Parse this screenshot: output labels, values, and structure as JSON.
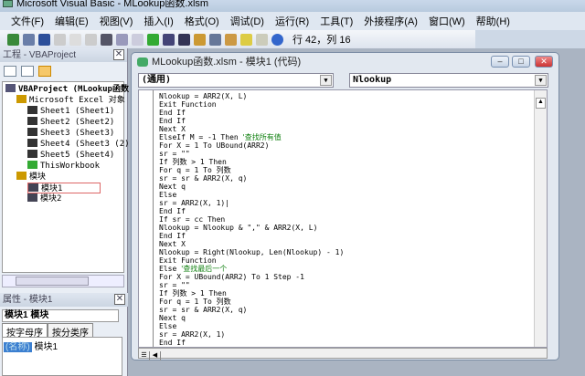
{
  "window": {
    "title": "Microsoft Visual Basic - MLookup函数.xlsm"
  },
  "menu": [
    "文件(F)",
    "编辑(E)",
    "视图(V)",
    "插入(I)",
    "格式(O)",
    "调试(D)",
    "运行(R)",
    "工具(T)",
    "外接程序(A)",
    "窗口(W)",
    "帮助(H)"
  ],
  "toolbar": {
    "position": "行 42，列 16"
  },
  "project": {
    "title": "工程 - VBAProject",
    "close": "✕",
    "nodes": [
      "VBAProject (MLookup函数",
      "Microsoft Excel 对象",
      "Sheet1 (Sheet1)",
      "Sheet2 (Sheet2)",
      "Sheet3 (Sheet3)",
      "Sheet4 (Sheet3 (2))",
      "Sheet5 (Sheet4)",
      "ThisWorkbook",
      "模块",
      "模块1",
      "模块2"
    ]
  },
  "properties": {
    "title": "属性 - 模块1",
    "close": "✕",
    "object": "模块1 模块",
    "tabs": [
      "按字母序",
      "按分类序"
    ],
    "prop_name": "(名称)",
    "prop_value": "模块1"
  },
  "code_window": {
    "title": "MLookup函数.xlsm - 模块1 (代码)",
    "object_combo": "(通用)",
    "proc_combo": "Nlookup",
    "lines": [
      {
        "t": "Nlookup = ARR2(X, L)"
      },
      {
        "t": "Exit Function"
      },
      {
        "t": "End If"
      },
      {
        "t": "End If"
      },
      {
        "t": "Next X"
      },
      {
        "t": "ElseIf M = -1 Then ",
        "c": "'查找所有值"
      },
      {
        "t": "For X = 1 To UBound(ARR2)"
      },
      {
        "t": "sr = \"\""
      },
      {
        "t": "If 列数 > 1 Then"
      },
      {
        "t": "For q = 1 To 列数"
      },
      {
        "t": "sr = sr & ARR2(X, q)"
      },
      {
        "t": "Next q"
      },
      {
        "t": "Else"
      },
      {
        "t": "sr = ARR2(X, 1)|"
      },
      {
        "t": "End If"
      },
      {
        "t": "If sr = cc Then"
      },
      {
        "t": "Nlookup = Nlookup & \",\" & ARR2(X, L)"
      },
      {
        "t": "End If"
      },
      {
        "t": "Next X"
      },
      {
        "t": "Nlookup = Right(Nlookup, Len(Nlookup) - 1)"
      },
      {
        "t": "Exit Function"
      },
      {
        "t": "Else ",
        "c": "'查找最后一个"
      },
      {
        "t": "For X = UBound(ARR2) To 1 Step -1"
      },
      {
        "t": "sr = \"\""
      },
      {
        "t": "If 列数 > 1 Then"
      },
      {
        "t": "For q = 1 To 列数"
      },
      {
        "t": "sr = sr & ARR2(X, q)"
      },
      {
        "t": "Next q"
      },
      {
        "t": "Else"
      },
      {
        "t": "sr = ARR2(X, 1)"
      },
      {
        "t": "End If"
      }
    ]
  }
}
